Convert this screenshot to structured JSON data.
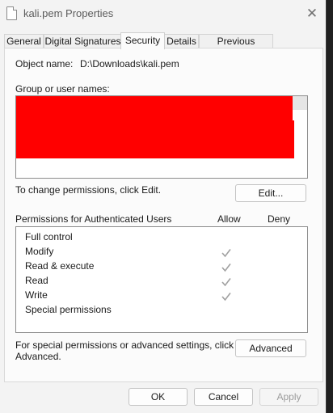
{
  "window": {
    "title": "kali.pem Properties",
    "close_glyph": "✕"
  },
  "tabs": [
    {
      "label": "General",
      "active": false
    },
    {
      "label": "Digital Signatures",
      "active": false
    },
    {
      "label": "Security",
      "active": true
    },
    {
      "label": "Details",
      "active": false
    },
    {
      "label": "Previous Versions",
      "active": false
    }
  ],
  "security": {
    "object_name_label": "Object name:",
    "object_name_value": "D:\\Downloads\\kali.pem",
    "group_label": "Group or user names:",
    "change_text": "To change permissions, click Edit.",
    "edit_button": "Edit...",
    "permissions_header": "Permissions for Authenticated Users",
    "allow_header": "Allow",
    "deny_header": "Deny",
    "permissions": [
      {
        "name": "Full control",
        "allow": false,
        "deny": false
      },
      {
        "name": "Modify",
        "allow": true,
        "deny": false
      },
      {
        "name": "Read & execute",
        "allow": true,
        "deny": false
      },
      {
        "name": "Read",
        "allow": true,
        "deny": false
      },
      {
        "name": "Write",
        "allow": true,
        "deny": false
      },
      {
        "name": "Special permissions",
        "allow": false,
        "deny": false
      }
    ],
    "special_text_line1": "For special permissions or advanced settings, click",
    "special_text_line2": "Advanced.",
    "advanced_button": "Advanced"
  },
  "footer": {
    "ok": "OK",
    "cancel": "Cancel",
    "apply": "Apply"
  },
  "colors": {
    "redaction": "#ff0000",
    "check_inherited": "#a0a0a0"
  }
}
